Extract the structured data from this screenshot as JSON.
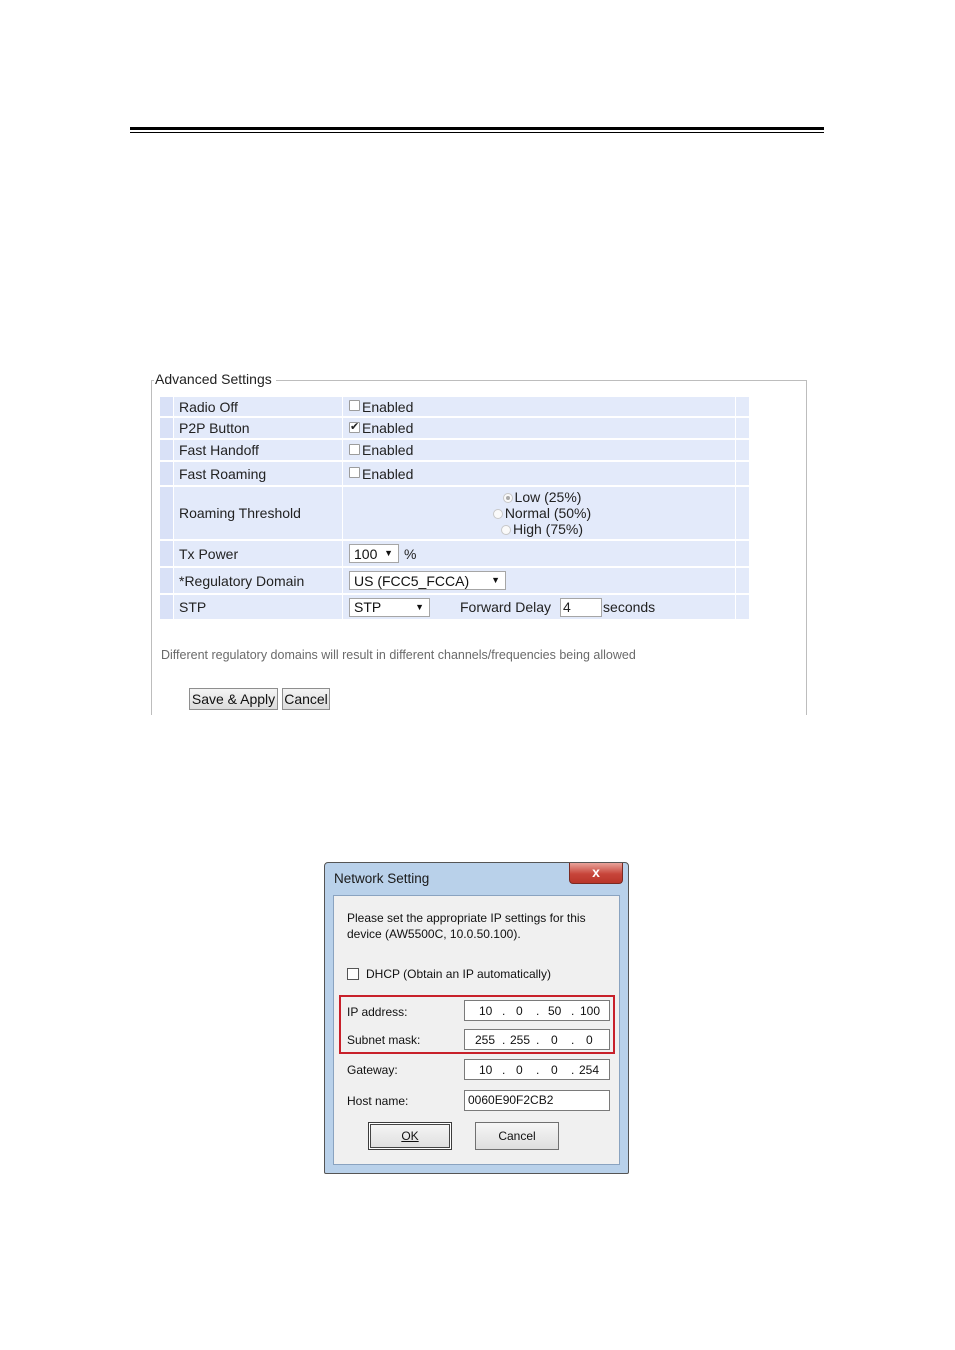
{
  "advanced": {
    "legend": "Advanced Settings",
    "rows": [
      {
        "label": "Radio Off",
        "value": "Enabled",
        "checked": false
      },
      {
        "label": "P2P Button",
        "value": "Enabled",
        "checked": true
      },
      {
        "label": "Fast Handoff",
        "value": "Enabled",
        "checked": false
      },
      {
        "label": "Fast Roaming",
        "value": "Enabled",
        "checked": false
      }
    ],
    "roaming": {
      "label": "Roaming Threshold",
      "options": [
        "Low (25%)",
        "Normal (50%)",
        "High (75%)"
      ],
      "selected": "Low (25%)"
    },
    "tx_power": {
      "label": "Tx Power",
      "value": "100",
      "unit": "%"
    },
    "regulatory": {
      "label": "*Regulatory Domain",
      "value": "US (FCC5_FCCA)"
    },
    "stp": {
      "label": "STP",
      "value": "STP",
      "forward_label": "Forward Delay",
      "forward_value": "4",
      "seconds_label": "seconds"
    },
    "note": "Different regulatory domains will result in different channels/frequencies being allowed",
    "save_label": "Save & Apply",
    "cancel_label": "Cancel"
  },
  "dialog": {
    "title": "Network Setting",
    "close_glyph": "x",
    "message_line1": "Please set the appropriate IP settings for this",
    "message_line2": "device (AW5500C, 10.0.50.100).",
    "dhcp_label": "DHCP (Obtain an IP automatically)",
    "dhcp_checked": false,
    "ip_label": "IP address:",
    "ip": [
      "10",
      "0",
      "50",
      "100"
    ],
    "subnet_label": "Subnet mask:",
    "subnet": [
      "255",
      "255",
      "0",
      "0"
    ],
    "gateway_label": "Gateway:",
    "gateway": [
      "10",
      "0",
      "0",
      "254"
    ],
    "host_label": "Host name:",
    "host": "0060E90F2CB2",
    "ok_label": "OK",
    "cancel_label": "Cancel",
    "highlight_color": "#c8202a"
  }
}
